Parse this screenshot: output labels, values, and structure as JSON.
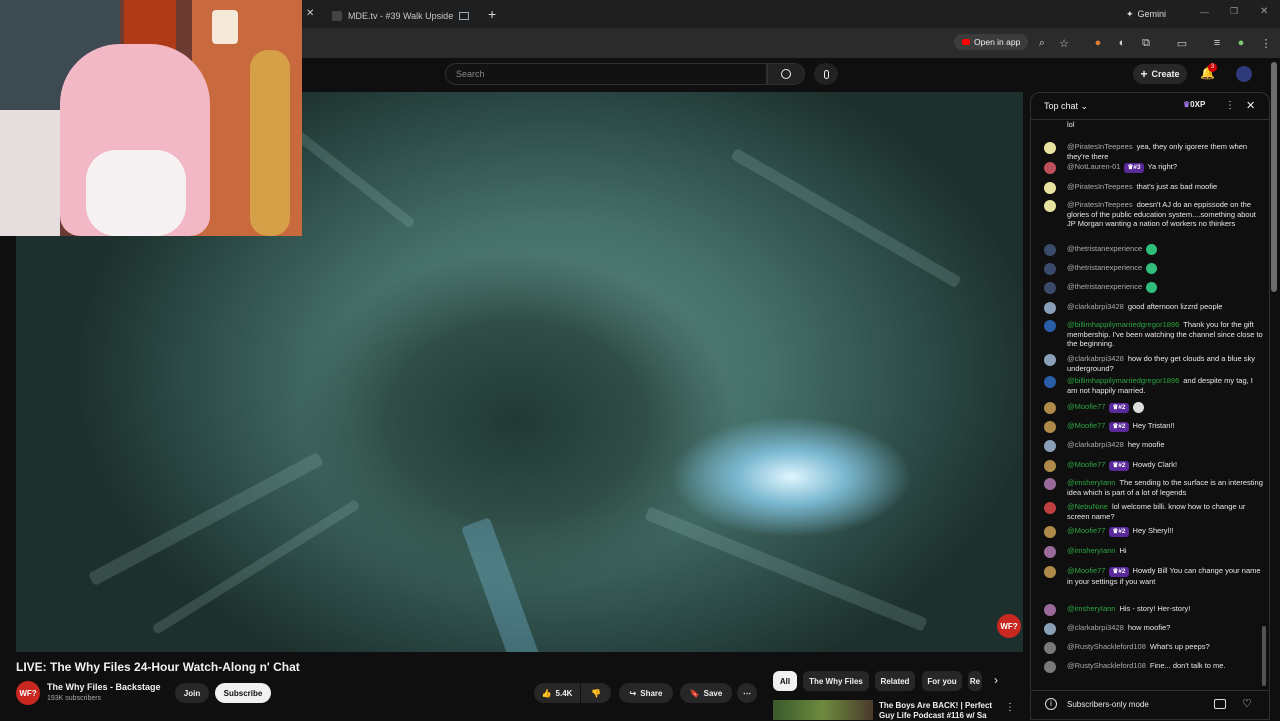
{
  "browser": {
    "tab_title": "MDE.tv - #39 Walk Upside",
    "gemini_label": "Gemini",
    "open_in_app_label": "Open in app"
  },
  "header": {
    "search_placeholder": "Search",
    "create_label": "Create",
    "notification_count": "3"
  },
  "video": {
    "title": "LIVE: The Why Files 24-Hour Watch-Along n' Chat",
    "logo_text": "WF?",
    "channel_name": "The Why Files - Backstage",
    "subscribers": "193K subscribers",
    "join_label": "Join",
    "subscribe_label": "Subscribe",
    "likes": "5.4K",
    "share_label": "Share",
    "save_label": "Save"
  },
  "chips": [
    "All",
    "The Why Files",
    "Related",
    "For you",
    "Re"
  ],
  "recommended": {
    "title": "The Boys Are BACK! | Perfect Guy Life Podcast #116 w/ Sa"
  },
  "chat": {
    "title": "Top chat",
    "xp": "0XP",
    "footer_mode": "Subscribers-only mode",
    "messages": [
      {
        "author": "",
        "text": "lol",
        "avatar_color": "#0f0f0f",
        "member": false,
        "badge": ""
      },
      {
        "author": "@PiratesInTeepees",
        "text": "yea, they only igorere them when they're there",
        "avatar_color": "#e8e4a0",
        "member": false,
        "badge": ""
      },
      {
        "author": "@NotLauren-01",
        "text": "Ya right?",
        "avatar_color": "#c0505a",
        "member": false,
        "badge": "#3"
      },
      {
        "author": "@PiratesInTeepees",
        "text": "that's just as bad moofie",
        "avatar_color": "#e8e4a0",
        "member": false,
        "badge": ""
      },
      {
        "author": "@PiratesInTeepees",
        "text": "doesn't AJ do an eppissode on the glories of the public education system....something about JP Morgan wanting a nation of workers no thinkers",
        "avatar_color": "#e8e4a0",
        "member": false,
        "badge": ""
      },
      {
        "author": "@thetristanexperience",
        "text": "",
        "avatar_color": "#3a4a6a",
        "member": false,
        "badge": ""
      },
      {
        "author": "@thetristanexperience",
        "text": "",
        "avatar_color": "#3a4a6a",
        "member": false,
        "badge": ""
      },
      {
        "author": "@thetristanexperience",
        "text": "",
        "avatar_color": "#3a4a6a",
        "member": false,
        "badge": ""
      },
      {
        "author": "@clarkabrpi3428",
        "text": "good afternoon lizzrd people",
        "avatar_color": "#8aa0b8",
        "member": false,
        "badge": ""
      },
      {
        "author": "@billimhappilymarriedgregor1896",
        "text": "Thank you for the gift membership. I've been watching the channel since close to the beginning.",
        "avatar_color": "#2a5caa",
        "member": true,
        "badge": ""
      },
      {
        "author": "@clarkabrpi3428",
        "text": "how do they get clouds and a blue sky underground?",
        "avatar_color": "#8aa0b8",
        "member": false,
        "badge": ""
      },
      {
        "author": "@billimhappilymarriedgregor1896",
        "text": "and despite my tag, I am not happily married.",
        "avatar_color": "#2a5caa",
        "member": true,
        "badge": ""
      },
      {
        "author": "@Moofie77",
        "text": "",
        "avatar_color": "#b08a4a",
        "member": true,
        "badge": "#2"
      },
      {
        "author": "@Moofie77",
        "text": "Hey Tristan!!",
        "avatar_color": "#b08a4a",
        "member": true,
        "badge": "#2"
      },
      {
        "author": "@clarkabrpi3428",
        "text": "hey moofie",
        "avatar_color": "#8aa0b8",
        "member": false,
        "badge": ""
      },
      {
        "author": "@Moofie77",
        "text": "Howdy Clark!",
        "avatar_color": "#b08a4a",
        "member": true,
        "badge": "#2"
      },
      {
        "author": "@imsheryIann",
        "text": "The sending to the surface is an interesting idea which is part of a lot of legends",
        "avatar_color": "#9a6a9a",
        "member": true,
        "badge": ""
      },
      {
        "author": "@NebuNine",
        "text": "lol welcome billi. know how to change ur screen name?",
        "avatar_color": "#c04040",
        "member": true,
        "badge": ""
      },
      {
        "author": "@Moofie77",
        "text": "Hey Sheryl!!",
        "avatar_color": "#b08a4a",
        "member": true,
        "badge": "#2"
      },
      {
        "author": "@imsheryIann",
        "text": "Hi",
        "avatar_color": "#9a6a9a",
        "member": true,
        "badge": ""
      },
      {
        "author": "@Moofie77",
        "text": "Howdy Bill You can change your name in your settings if you want",
        "avatar_color": "#b08a4a",
        "member": true,
        "badge": "#2"
      },
      {
        "author": "@imsheryIann",
        "text": "His - story! Her-story!",
        "avatar_color": "#9a6a9a",
        "member": true,
        "badge": ""
      },
      {
        "author": "@clarkabrpi3428",
        "text": "how moofie?",
        "avatar_color": "#8aa0b8",
        "member": false,
        "badge": ""
      },
      {
        "author": "@RustyShackleford108",
        "text": "What's up peeps?",
        "avatar_color": "#7a7a7a",
        "member": false,
        "badge": ""
      },
      {
        "author": "@RustyShackleford108",
        "text": "Fine... don't talk to me.",
        "avatar_color": "#7a7a7a",
        "member": false,
        "badge": ""
      }
    ]
  }
}
